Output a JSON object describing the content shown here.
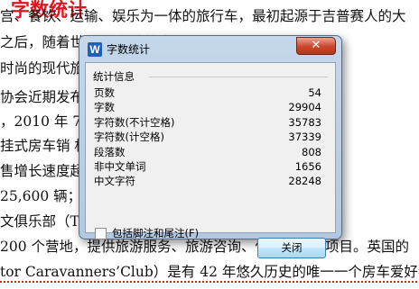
{
  "document": {
    "title": "字数统计",
    "lines": [
      "宫、餐饮、运输、娱乐为一体的旅行车，最初起源于吉普赛人的大",
      "之后，随着世                                  房车制造技术",
      "时尚的现代旅",
      "协会近期发布                                 根据统计报告，",
      "，2010 年 7                                  中自行式房车",
      "挂式房车销                                    相对于 2010",
      "售增长速度超                                  2010 年 7 月",
      "25,600 辆；挂",
      "文俱乐部（Th                                  部。它拥有近",
      " 200 个营地，提供旅游服务、旅游咨询、保险等服务项目。英国的",
      "tor Caravanners’Club）是有 42 年悠久历史的唯一一个房车爱好者自"
    ]
  },
  "dialog": {
    "icon_label": "W",
    "title": "字数统计",
    "close_label": "✕",
    "group_label": "统计信息",
    "stats": [
      {
        "label": "页数",
        "value": "54"
      },
      {
        "label": "字数",
        "value": "29904"
      },
      {
        "label": "字符数(不计空格)",
        "value": "35783"
      },
      {
        "label": "字符数(计空格)",
        "value": "37339"
      },
      {
        "label": "段落数",
        "value": "808"
      },
      {
        "label": "非中文单词",
        "value": "1656"
      },
      {
        "label": "中文字符",
        "value": "28248"
      }
    ],
    "checkbox_label": "包括脚注和尾注(F)",
    "checkbox_checked": false,
    "ok_label": "关闭"
  }
}
